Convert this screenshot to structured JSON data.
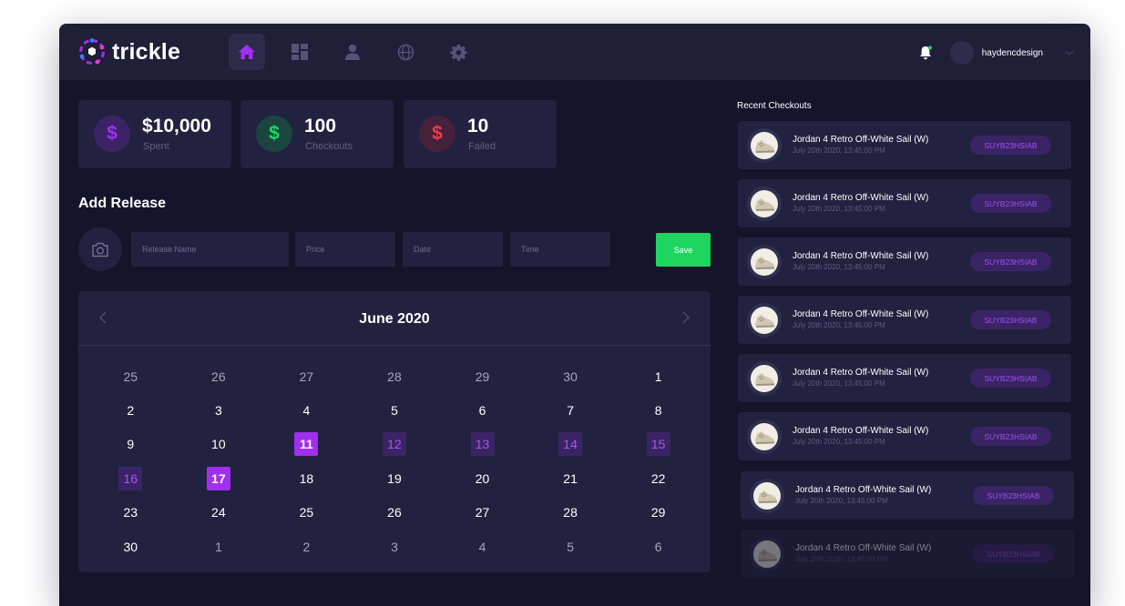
{
  "app": {
    "name": "trickle",
    "colors": {
      "bg": "#14142a",
      "panel": "#222240",
      "accent": "#a02ff0",
      "success": "#1ed65f"
    }
  },
  "nav": {
    "items": [
      {
        "name": "home",
        "icon": "home-icon",
        "active": true
      },
      {
        "name": "dashboard",
        "icon": "dashboard-icon",
        "active": false
      },
      {
        "name": "user",
        "icon": "user-icon",
        "active": false
      },
      {
        "name": "globe",
        "icon": "globe-icon",
        "active": false
      },
      {
        "name": "settings",
        "icon": "gear-icon",
        "active": false
      }
    ]
  },
  "user": {
    "username": "haydencdesign"
  },
  "stats": [
    {
      "value": "$10,000",
      "label": "Spent",
      "color": "#a02ff0"
    },
    {
      "value": "100",
      "label": "Checkouts",
      "color": "#1ed65f"
    },
    {
      "value": "10",
      "label": "Failed",
      "color": "#ee3b4a"
    }
  ],
  "add_release": {
    "title": "Add Release",
    "fields": [
      {
        "placeholder": "Release Name"
      },
      {
        "placeholder": "Price"
      },
      {
        "placeholder": "Date"
      },
      {
        "placeholder": "Time"
      }
    ],
    "save_label": "Save"
  },
  "calendar": {
    "title": "June 2020",
    "days": [
      {
        "d": "25",
        "t": "muted"
      },
      {
        "d": "26",
        "t": "muted"
      },
      {
        "d": "27",
        "t": "muted"
      },
      {
        "d": "28",
        "t": "muted"
      },
      {
        "d": "29",
        "t": "muted"
      },
      {
        "d": "30",
        "t": "muted"
      },
      {
        "d": "1",
        "t": "normal"
      },
      {
        "d": "2",
        "t": "normal"
      },
      {
        "d": "3",
        "t": "normal"
      },
      {
        "d": "4",
        "t": "normal"
      },
      {
        "d": "5",
        "t": "normal"
      },
      {
        "d": "6",
        "t": "normal"
      },
      {
        "d": "7",
        "t": "normal"
      },
      {
        "d": "8",
        "t": "normal"
      },
      {
        "d": "9",
        "t": "normal"
      },
      {
        "d": "10",
        "t": "normal"
      },
      {
        "d": "11",
        "t": "selected"
      },
      {
        "d": "12",
        "t": "range"
      },
      {
        "d": "13",
        "t": "range"
      },
      {
        "d": "14",
        "t": "range"
      },
      {
        "d": "15",
        "t": "range"
      },
      {
        "d": "16",
        "t": "range"
      },
      {
        "d": "17",
        "t": "selected"
      },
      {
        "d": "18",
        "t": "normal"
      },
      {
        "d": "19",
        "t": "normal"
      },
      {
        "d": "20",
        "t": "normal"
      },
      {
        "d": "21",
        "t": "normal"
      },
      {
        "d": "22",
        "t": "normal"
      },
      {
        "d": "23",
        "t": "normal"
      },
      {
        "d": "24",
        "t": "normal"
      },
      {
        "d": "25",
        "t": "normal"
      },
      {
        "d": "26",
        "t": "normal"
      },
      {
        "d": "27",
        "t": "normal"
      },
      {
        "d": "28",
        "t": "normal"
      },
      {
        "d": "29",
        "t": "normal"
      },
      {
        "d": "30",
        "t": "normal"
      },
      {
        "d": "1",
        "t": "muted"
      },
      {
        "d": "2",
        "t": "muted"
      },
      {
        "d": "3",
        "t": "muted"
      },
      {
        "d": "4",
        "t": "muted"
      },
      {
        "d": "5",
        "t": "muted"
      },
      {
        "d": "6",
        "t": "muted"
      }
    ]
  },
  "recent_checkouts": {
    "title": "Recent Checkouts",
    "items": [
      {
        "name": "Jordan 4 Retro Off-White Sail (W)",
        "date": "July 20th 2020, 13:45:00 PM",
        "code": "SUYB23HSIAB"
      },
      {
        "name": "Jordan 4 Retro Off-White Sail (W)",
        "date": "July 20th 2020, 13:45:00 PM",
        "code": "SUYB23HSIAB"
      },
      {
        "name": "Jordan 4 Retro Off-White Sail (W)",
        "date": "July 20th 2020, 13:45:00 PM",
        "code": "SUYB23HSIAB"
      },
      {
        "name": "Jordan 4 Retro Off-White Sail (W)",
        "date": "July 20th 2020, 13:45:00 PM",
        "code": "SUYB23HSIAB"
      },
      {
        "name": "Jordan 4 Retro Off-White Sail (W)",
        "date": "July 20th 2020, 13:45:00 PM",
        "code": "SUYB23HSIAB"
      },
      {
        "name": "Jordan 4 Retro Off-White Sail (W)",
        "date": "July 20th 2020, 13:45:00 PM",
        "code": "SUYB23HSIAB"
      },
      {
        "name": "Jordan 4 Retro Off-White Sail (W)",
        "date": "July 20th 2020, 13:45:00 PM",
        "code": "SUYB23HSIAB"
      },
      {
        "name": "Jordan 4 Retro Off-White Sail (W)",
        "date": "July 20th 2020, 13:45:00 PM",
        "code": "SUYB23HSIAB"
      }
    ]
  }
}
